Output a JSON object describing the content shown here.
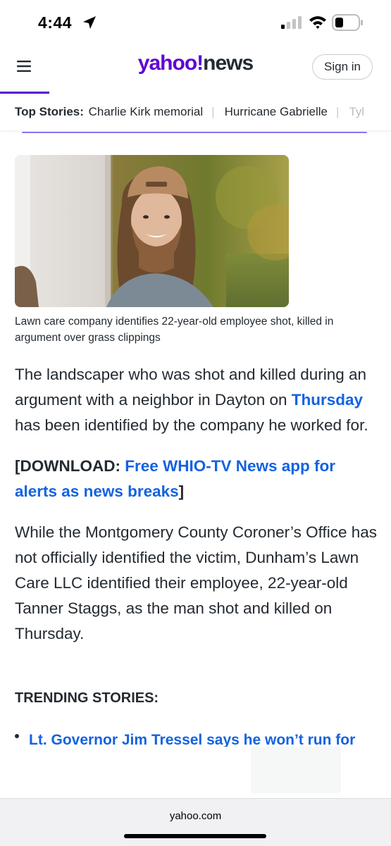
{
  "status_bar": {
    "time": "4:44",
    "icons": [
      "location-arrow-icon",
      "cellular-signal-icon",
      "wifi-icon",
      "battery-icon"
    ]
  },
  "header": {
    "logo_yahoo": "yahoo",
    "logo_bang": "!",
    "logo_news": "news",
    "sign_in_label": "Sign in",
    "menu_icon": "hamburger-menu-icon",
    "brand_color": "#6001d2"
  },
  "top_stories": {
    "label": "Top Stories:",
    "items": [
      "Charlie Kirk memorial",
      "Hurricane Gabrielle",
      "Tyl"
    ]
  },
  "article": {
    "image_caption": "Lawn care company identifies 22-year-old employee shot, killed in argument over grass clippings",
    "p1_text_a": "The landscaper who was shot and killed during an argument with a neighbor in Dayton on ",
    "p1_link": "Thursday",
    "p1_text_b": " has been identified by the company he worked for.",
    "p2_prefix": "[DOWNLOAD: ",
    "p2_link": "Free WHIO-TV News app for alerts as news breaks",
    "p2_suffix": "]",
    "p3_text": "While the Montgomery County Coroner’s Office has not officially identified the victim, Dunham’s Lawn Care LLC identified their employee, 22-year-old Tanner Staggs, as the man shot and killed on Thursday.",
    "trending_heading": "TRENDING STORIES:",
    "trending_items": [
      "Lt. Governor Jim Tressel says he won’t run for"
    ],
    "link_color": "#1462e1"
  },
  "browser": {
    "url": "yahoo.com"
  }
}
